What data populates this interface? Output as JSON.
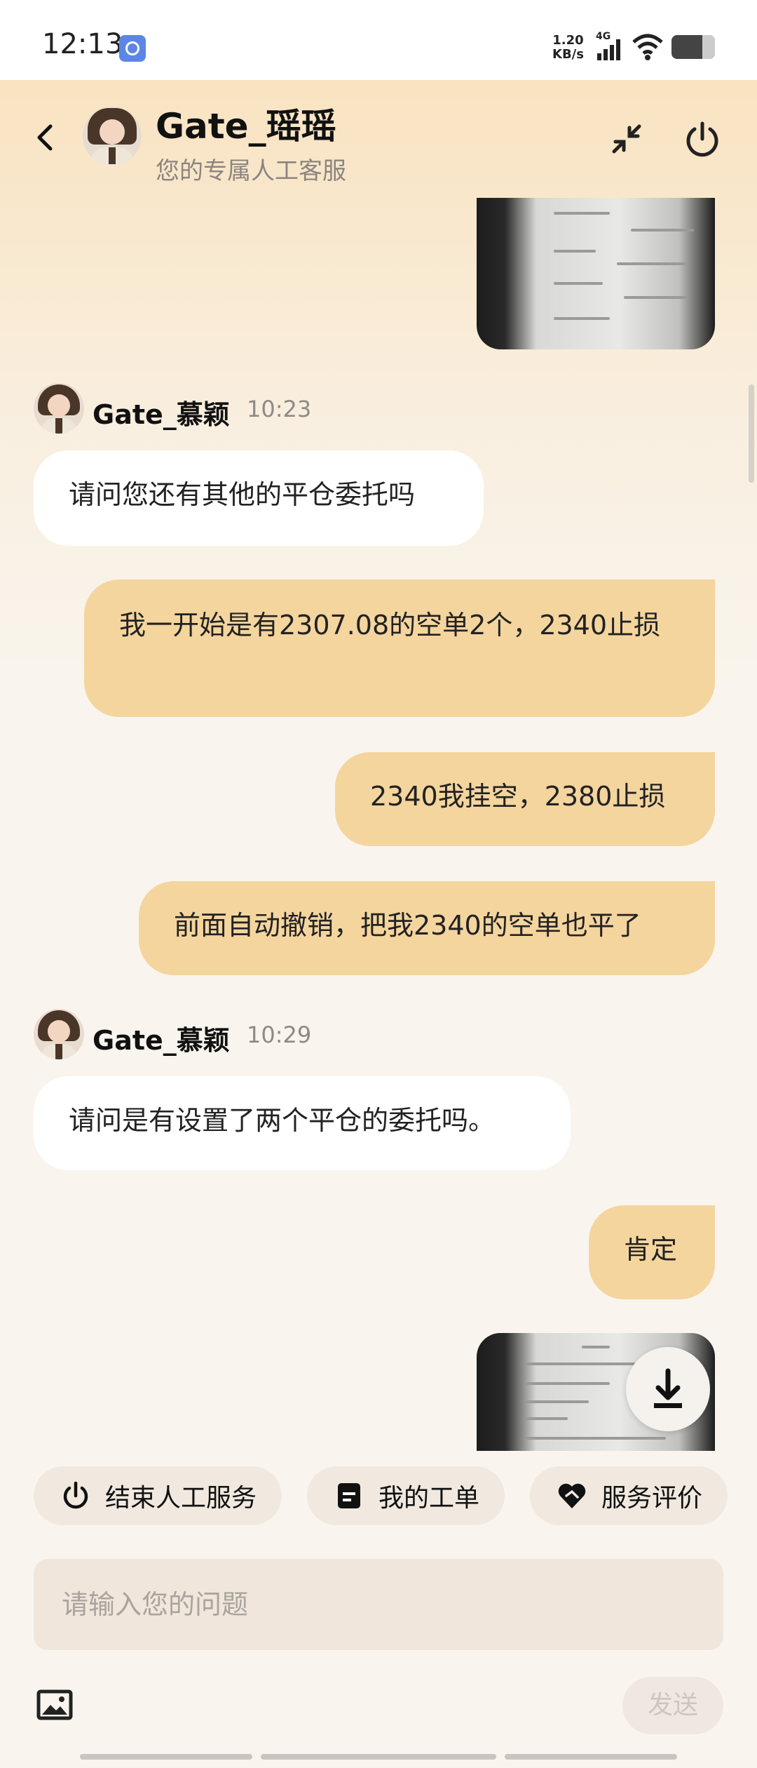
{
  "status_bar": {
    "time": "12:13",
    "net_speed_value": "1.20",
    "net_speed_unit": "KB/s",
    "network_type": "4G"
  },
  "header": {
    "title": "Gate_瑶瑶",
    "subtitle": "您的专属人工客服"
  },
  "messages": [
    {
      "agent": "Gate_慕颖",
      "time": "10:23",
      "text": "请问您还有其他的平仓委托吗"
    },
    {
      "text_out_1": "我一开始是有2307.08的空单2个，2340止损"
    },
    {
      "text_out_2": "2340我挂空，2380止损"
    },
    {
      "text_out_3": "前面自动撤销，把我2340的空单也平了"
    },
    {
      "agent": "Gate_慕颖",
      "time": "10:29",
      "text": "请问是有设置了两个平仓的委托吗。"
    },
    {
      "text_out_4": "肯定"
    }
  ],
  "quick_actions": {
    "end_service": "结束人工服务",
    "my_tickets": "我的工单",
    "rate_service": "服务评价"
  },
  "input": {
    "placeholder": "请输入您的问题",
    "send_label": "发送"
  },
  "colors": {
    "outgoing_bubble": "#f4d59e",
    "incoming_bubble": "#ffffff",
    "header_gradient_top": "#f9e3c1"
  }
}
